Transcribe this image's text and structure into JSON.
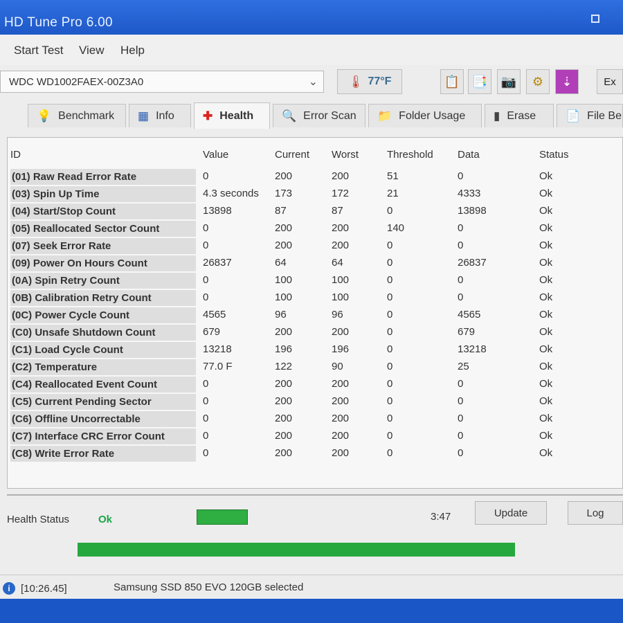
{
  "window": {
    "title": "HD Tune Pro 6.00"
  },
  "menu": [
    "Start Test",
    "View",
    "Help"
  ],
  "toolbar": {
    "drive": "WDC WD1002FAEX-00Z3A0",
    "temperature": "77°F",
    "exit_label": "Ex",
    "icons": [
      "copy-icon",
      "copy-all-icon",
      "camera-icon",
      "options-icon",
      "save-icon"
    ]
  },
  "tabs": [
    {
      "label": "Benchmark",
      "icon": "lightbulb-icon"
    },
    {
      "label": "Info",
      "icon": "info-figure-icon"
    },
    {
      "label": "Health",
      "icon": "health-cross-icon",
      "active": true
    },
    {
      "label": "Error Scan",
      "icon": "magnifier-icon"
    },
    {
      "label": "Folder Usage",
      "icon": "folder-icon"
    },
    {
      "label": "Erase",
      "icon": "erase-icon"
    },
    {
      "label": "File Be...",
      "icon": "file-benchmark-icon"
    }
  ],
  "table": {
    "headers": [
      "ID",
      "Value",
      "Current",
      "Worst",
      "Threshold",
      "Data",
      "Status"
    ],
    "rows": [
      [
        "(01) Raw Read Error Rate",
        "0",
        "200",
        "200",
        "51",
        "0",
        "Ok"
      ],
      [
        "(03) Spin Up Time",
        "4.3 seconds",
        "173",
        "172",
        "21",
        "4333",
        "Ok"
      ],
      [
        "(04) Start/Stop Count",
        "13898",
        "87",
        "87",
        "0",
        "13898",
        "Ok"
      ],
      [
        "(05) Reallocated Sector Count",
        "0",
        "200",
        "200",
        "140",
        "0",
        "Ok"
      ],
      [
        "(07) Seek Error Rate",
        "0",
        "200",
        "200",
        "0",
        "0",
        "Ok"
      ],
      [
        "(09) Power On Hours Count",
        "26837",
        "64",
        "64",
        "0",
        "26837",
        "Ok"
      ],
      [
        "(0A) Spin Retry Count",
        "0",
        "100",
        "100",
        "0",
        "0",
        "Ok"
      ],
      [
        "(0B) Calibration Retry Count",
        "0",
        "100",
        "100",
        "0",
        "0",
        "Ok"
      ],
      [
        "(0C) Power Cycle Count",
        "4565",
        "96",
        "96",
        "0",
        "4565",
        "Ok"
      ],
      [
        "(C0) Unsafe Shutdown Count",
        "679",
        "200",
        "200",
        "0",
        "679",
        "Ok"
      ],
      [
        "(C1) Load Cycle Count",
        "13218",
        "196",
        "196",
        "0",
        "13218",
        "Ok"
      ],
      [
        "(C2) Temperature",
        "77.0 F",
        "122",
        "90",
        "0",
        "25",
        "Ok"
      ],
      [
        "(C4) Reallocated Event Count",
        "0",
        "200",
        "200",
        "0",
        "0",
        "Ok"
      ],
      [
        "(C5) Current Pending Sector",
        "0",
        "200",
        "200",
        "0",
        "0",
        "Ok"
      ],
      [
        "(C6) Offline Uncorrectable",
        "0",
        "200",
        "200",
        "0",
        "0",
        "Ok"
      ],
      [
        "(C7) Interface CRC Error Count",
        "0",
        "200",
        "200",
        "0",
        "0",
        "Ok"
      ],
      [
        "(C8) Write Error Rate",
        "0",
        "200",
        "200",
        "0",
        "0",
        "Ok"
      ]
    ]
  },
  "health": {
    "label": "Health Status",
    "value": "Ok",
    "time": "3:47",
    "update_label": "Update",
    "log_label": "Log",
    "progress": 1.0
  },
  "statusbar": {
    "time": "[10:26.45]",
    "message": "Samsung SSD 850 EVO 120GB selected"
  }
}
